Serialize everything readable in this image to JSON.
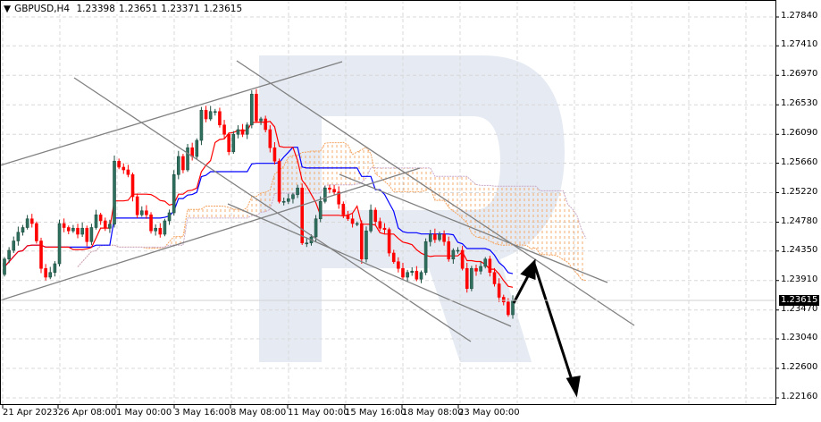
{
  "chart_data": {
    "type": "candlestick",
    "symbol": "GBPUSD",
    "timeframe": "H4",
    "ohlc_header": {
      "open": "1.23398",
      "high": "1.23651",
      "low": "1.23371",
      "close": "1.23615"
    },
    "ylim": [
      1.2195,
      1.2806
    ],
    "y_ticks": [
      "1.27840",
      "1.27410",
      "1.26970",
      "1.26530",
      "1.26090",
      "1.25660",
      "1.25220",
      "1.24780",
      "1.24350",
      "1.23910",
      "1.23470",
      "1.23040",
      "1.22600",
      "1.22160"
    ],
    "x_ticks": [
      "21 Apr 2023",
      "26 Apr 08:00",
      "1 May 00:00",
      "3 May 16:00",
      "8 May 08:00",
      "11 May 00:00",
      "15 May 16:00",
      "18 May 08:00",
      "23 May 00:00"
    ],
    "current_price": "1.23615",
    "closes": [
      1.2423,
      1.2436,
      1.245,
      1.2463,
      1.247,
      1.2483,
      1.2476,
      1.245,
      1.2409,
      1.2396,
      1.2403,
      1.2416,
      1.2476,
      1.247,
      1.2465,
      1.2469,
      1.246,
      1.2469,
      1.2449,
      1.247,
      1.2489,
      1.248,
      1.2469,
      1.2475,
      1.2569,
      1.256,
      1.2556,
      1.2549,
      1.2516,
      1.2489,
      1.2495,
      1.2489,
      1.2465,
      1.2469,
      1.246,
      1.248,
      1.2492,
      1.2549,
      1.2576,
      1.2556,
      1.2589,
      1.2576,
      1.26,
      1.2645,
      1.2632,
      1.2643,
      1.2643,
      1.2623,
      1.2609,
      1.2583,
      1.2609,
      1.2616,
      1.2609,
      1.2623,
      1.2669,
      1.2629,
      1.2632,
      1.2616,
      1.2589,
      1.2569,
      1.2509,
      1.2509,
      1.2513,
      1.2519,
      1.2529,
      1.2447,
      1.2447,
      1.2456,
      1.2483,
      1.2509,
      1.2529,
      1.2527,
      1.2523,
      1.2505,
      1.2489,
      1.2483,
      1.2476,
      1.2476,
      1.2423,
      1.2465,
      1.2496,
      1.2479,
      1.2469,
      1.2467,
      1.2432,
      1.2419,
      1.2409,
      1.2396,
      1.2403,
      1.2405,
      1.2393,
      1.2403,
      1.2449,
      1.246,
      1.2452,
      1.246,
      1.2449,
      1.2423,
      1.2436,
      1.2436,
      1.2409,
      1.2379,
      1.2409,
      1.2405,
      1.2412,
      1.2423,
      1.2403,
      1.2386,
      1.2366,
      1.2359,
      1.234,
      1.23615
    ],
    "first_open": 1.24,
    "indicator": "Ichimoku (9, 26, 52)",
    "colors": {
      "bull": "#2f6f5e",
      "bear": "#ff0000",
      "tenkan": "#ff0000",
      "kijun": "#0000ff",
      "spanA": "#f4a460",
      "spanB": "#c8a8c8",
      "grid": "#d8d8d8",
      "watermark": "#e6ebf3"
    }
  }
}
